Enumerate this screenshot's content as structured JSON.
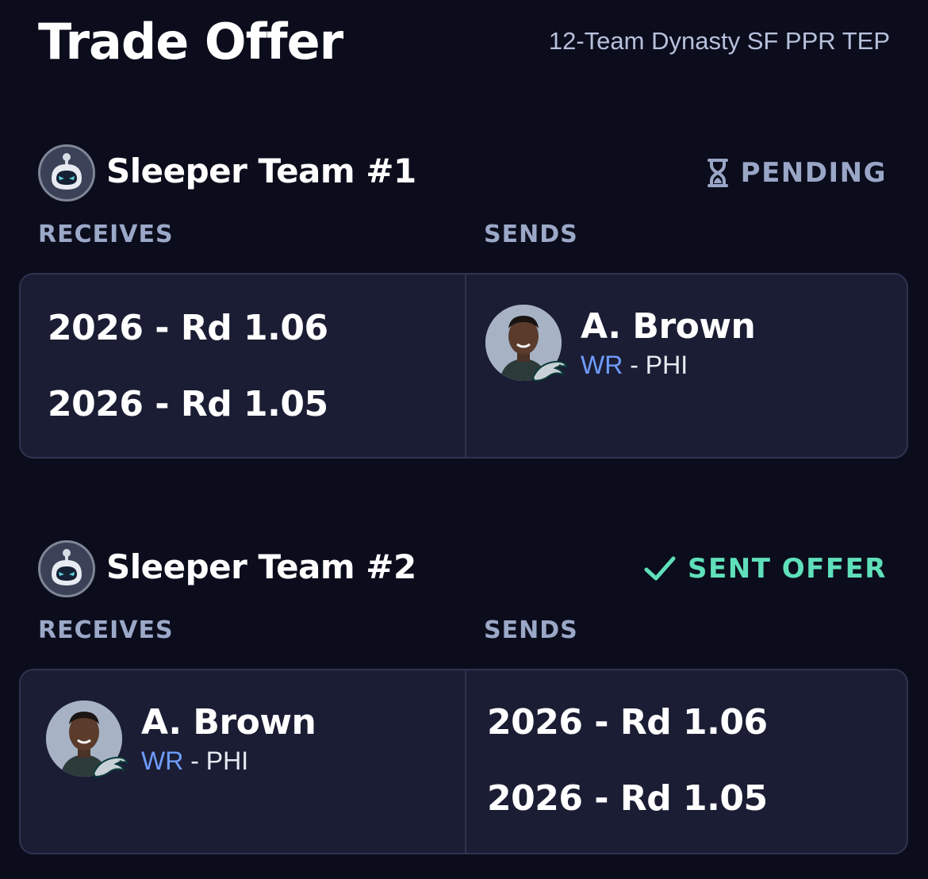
{
  "page": {
    "title": "Trade Offer",
    "league": "12-Team Dynasty SF PPR TEP"
  },
  "colors": {
    "background": "#0b0d1c",
    "card": "#1b1d34",
    "pending": "#9aa6c6",
    "sent": "#5fe0ba",
    "position": "#6f9dff"
  },
  "teams": [
    {
      "name": "Sleeper Team #1",
      "status": "PENDING",
      "status_icon": "hourglass-icon",
      "receives_label": "RECEIVES",
      "sends_label": "SENDS",
      "receives": [
        {
          "type": "pick",
          "label": "2026 - Rd 1.06"
        },
        {
          "type": "pick",
          "label": "2026 - Rd 1.05"
        }
      ],
      "sends": [
        {
          "type": "player",
          "name": "A. Brown",
          "position": "WR",
          "separator": " - ",
          "team": "PHI"
        }
      ]
    },
    {
      "name": "Sleeper Team #2",
      "status": "SENT OFFER",
      "status_icon": "check-icon",
      "receives_label": "RECEIVES",
      "sends_label": "SENDS",
      "receives": [
        {
          "type": "player",
          "name": "A. Brown",
          "position": "WR",
          "separator": " - ",
          "team": "PHI"
        }
      ],
      "sends": [
        {
          "type": "pick",
          "label": "2026 - Rd 1.06"
        },
        {
          "type": "pick",
          "label": "2026 - Rd 1.05"
        }
      ]
    }
  ]
}
